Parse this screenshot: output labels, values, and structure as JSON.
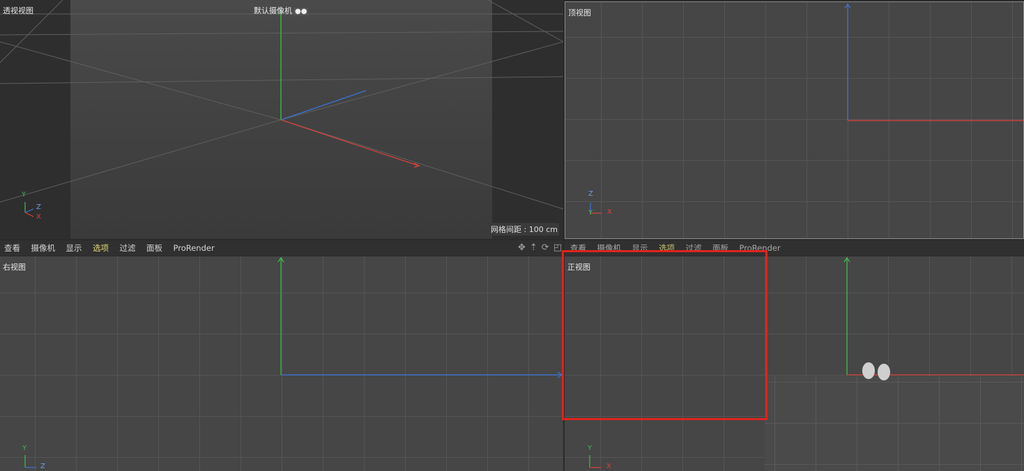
{
  "viewports": {
    "perspective": {
      "title": "透视视图",
      "camera": "默认摄像机",
      "grid_spacing": "网格间距 : 100 cm",
      "axes": {
        "y": "Y",
        "z": "Z",
        "x": "X"
      }
    },
    "top": {
      "title": "顶视图",
      "axes": {
        "z": "Z",
        "y": "Y",
        "x": "X"
      }
    },
    "right": {
      "title": "右视图",
      "axes": {
        "y": "Y",
        "z": "Z"
      }
    },
    "front": {
      "title": "正视图",
      "axes": {
        "y": "Y",
        "x": "X"
      }
    }
  },
  "menubar_left": {
    "items": [
      "查看",
      "摄像机",
      "显示",
      "选项",
      "过滤",
      "面板",
      "ProRender"
    ],
    "active": "选项"
  },
  "menubar_right": {
    "items": [
      "查看",
      "摄像机",
      "显示",
      "选项",
      "过滤",
      "面板",
      "ProRender"
    ],
    "active": "选项"
  },
  "nav_icons": [
    "move-view-icon",
    "zoom-view-icon",
    "rotate-view-icon",
    "maximize-view-icon"
  ],
  "colors": {
    "x_axis": "#d9423b",
    "y_axis": "#3fbf4a",
    "z_axis": "#3b73d9",
    "highlight": "#e0231c",
    "active_menu": "#e4d97a"
  }
}
